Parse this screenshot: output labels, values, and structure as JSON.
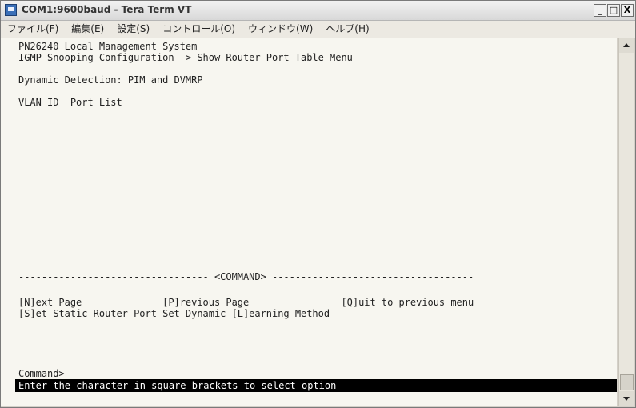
{
  "window": {
    "title": "COM1:9600baud - Tera Term VT",
    "minimize": "_",
    "maximize": "□",
    "close": "X"
  },
  "menu": {
    "items": [
      "ファイル(F)",
      "編集(E)",
      "設定(S)",
      "コントロール(O)",
      "ウィンドウ(W)",
      "ヘルプ(H)"
    ]
  },
  "terminal": {
    "lines": [
      "PN26240 Local Management System",
      "IGMP Snooping Configuration -> Show Router Port Table Menu",
      "",
      "Dynamic Detection: PIM and DVMRP",
      "",
      "VLAN ID  Port List",
      "-------  --------------------------------------------------------------",
      "",
      "",
      "",
      "",
      "",
      "",
      "",
      "",
      "",
      "",
      "",
      "--------------------------------- <COMMAND> -----------------------------------",
      "",
      "[N]ext Page              [P]revious Page                [Q]uit to previous menu",
      "[S]et Static Router Port Set Dynamic [L]earning Method",
      "",
      "",
      "",
      "",
      "",
      "",
      "Command>"
    ],
    "status": "Enter the character in square brackets to select option"
  },
  "scrollbar": {
    "position_percent": 100
  },
  "colors": {
    "terminal_bg": "#f7f6f0",
    "status_bg": "#000000",
    "status_fg": "#ffffff"
  }
}
